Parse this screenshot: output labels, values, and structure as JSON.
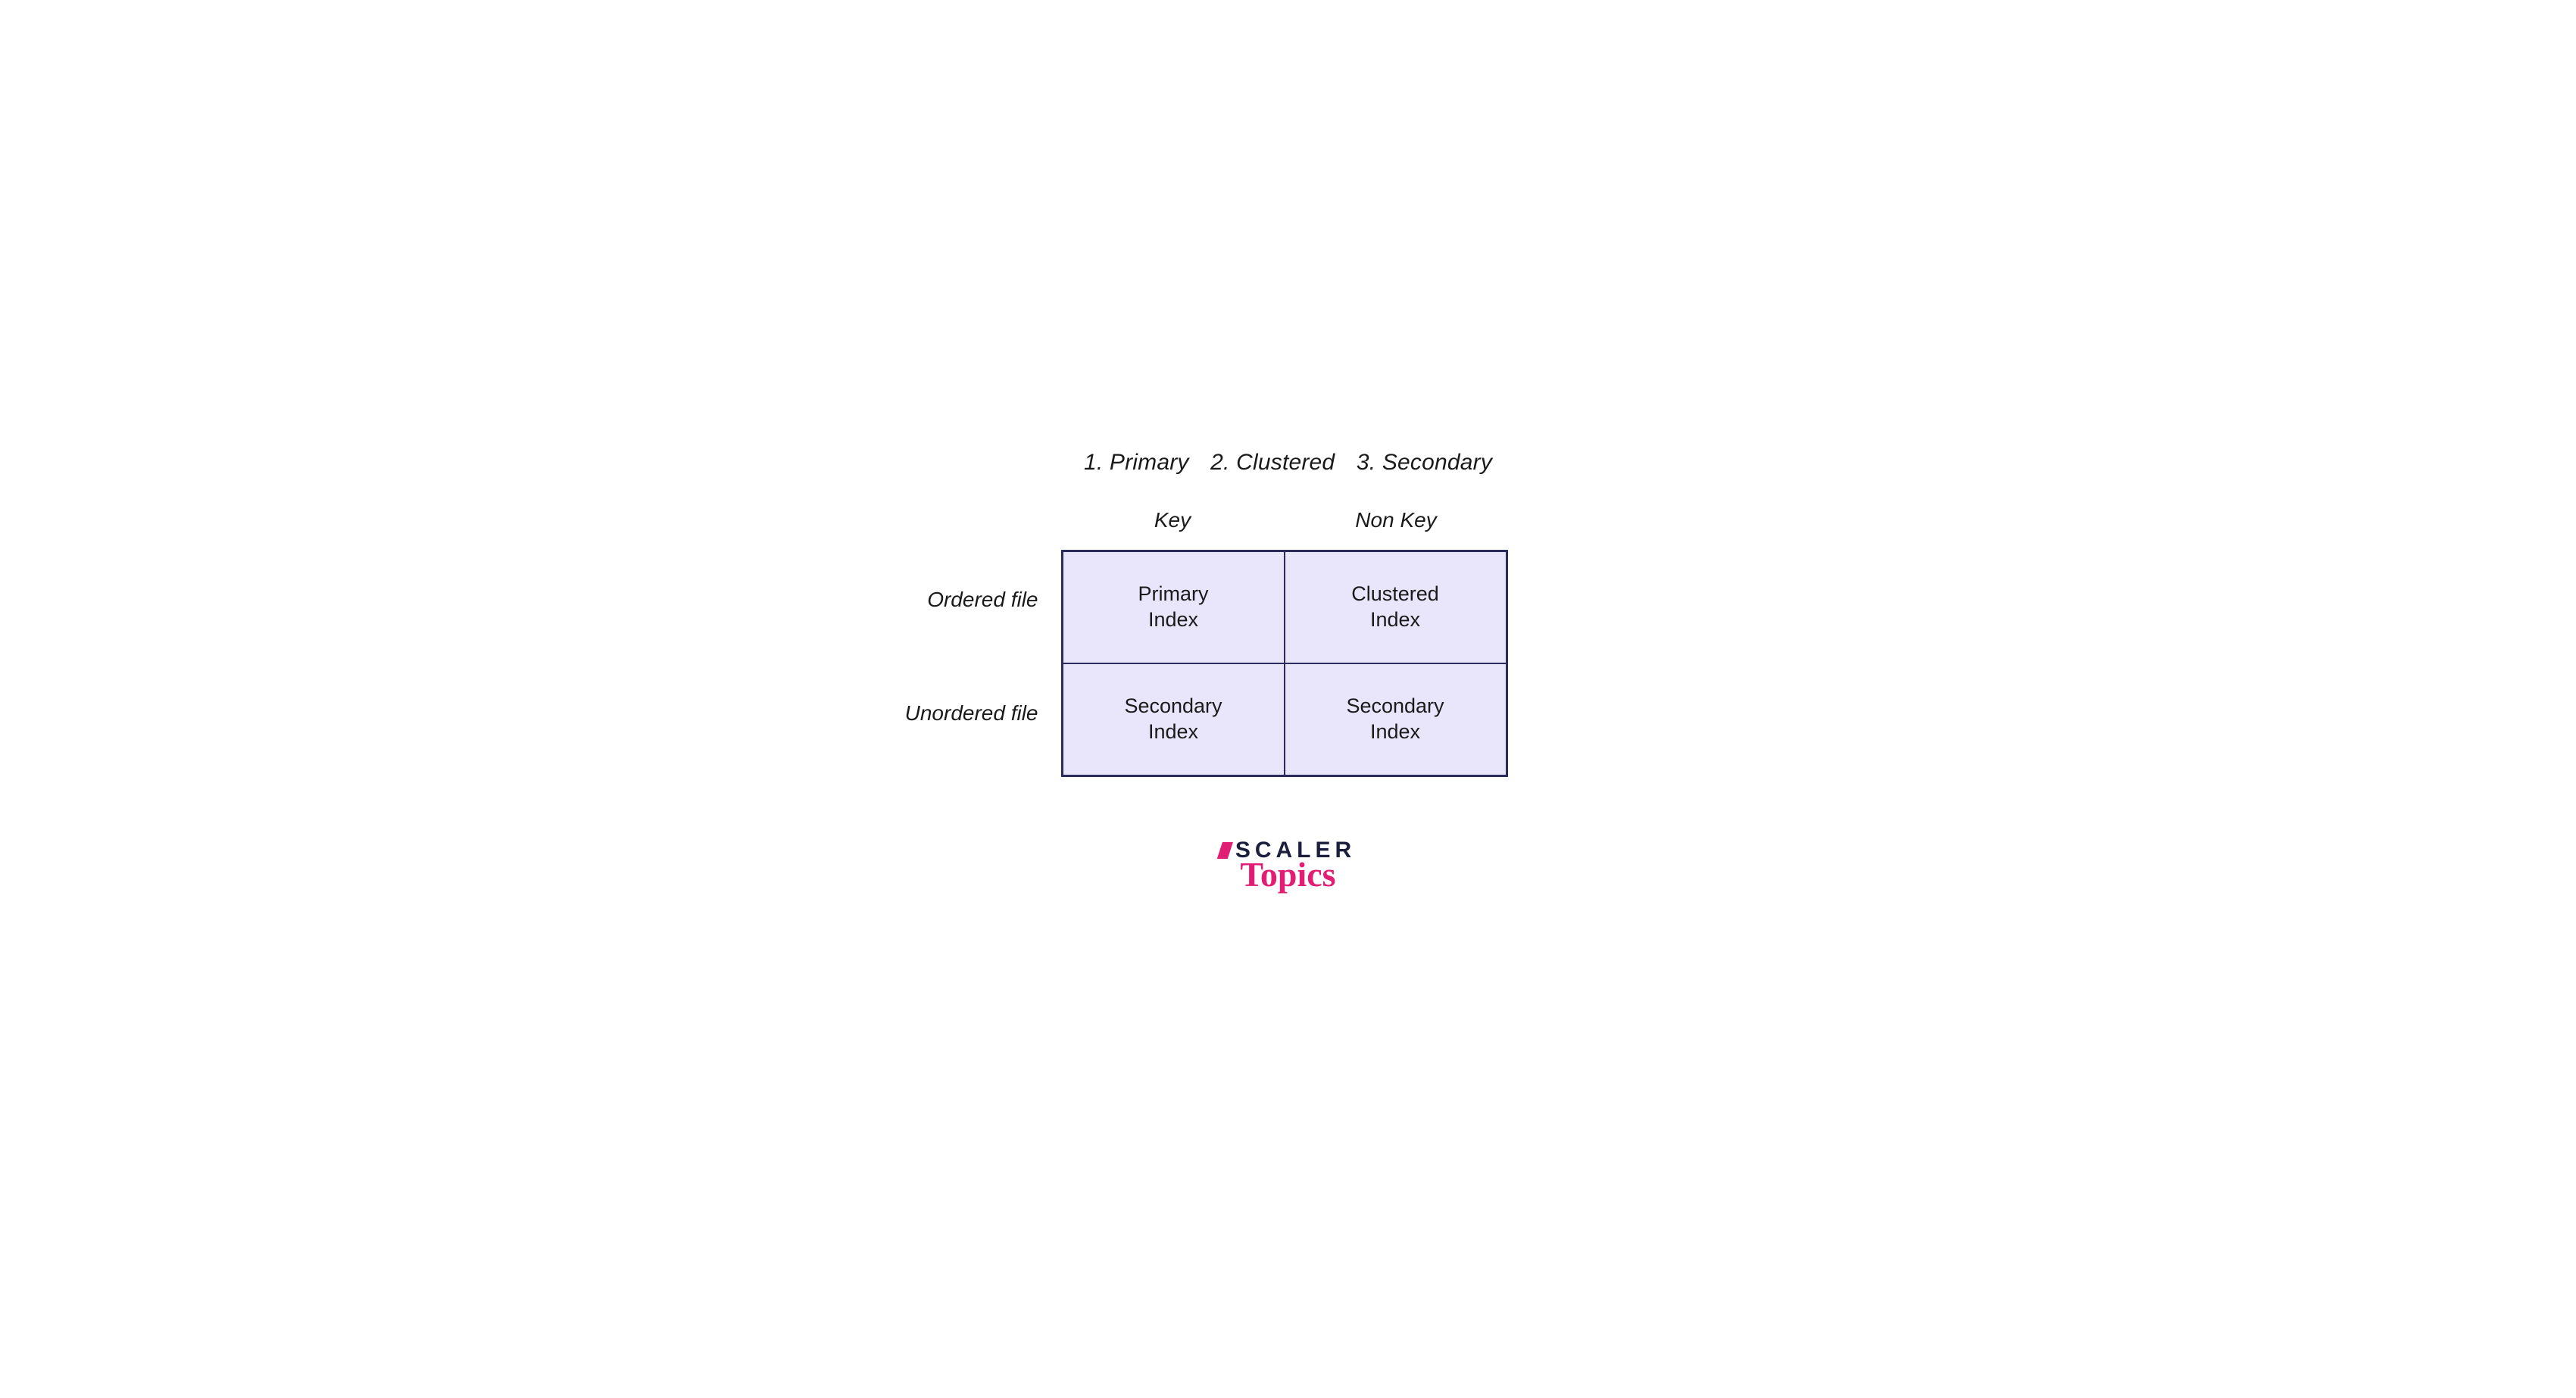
{
  "title": {
    "item1": "1. Primary",
    "item2": "2. Clustered",
    "item3": "3. Secondary"
  },
  "columns": {
    "key": "Key",
    "nonkey": "Non Key"
  },
  "rows": {
    "ordered": "Ordered file",
    "unordered": "Unordered file"
  },
  "cells": {
    "r1c1_l1": "Primary",
    "r1c1_l2": "Index",
    "r1c2_l1": "Clustered",
    "r1c2_l2": "Index",
    "r2c1_l1": "Secondary",
    "r2c1_l2": "Index",
    "r2c2_l1": "Secondary",
    "r2c2_l2": "Index"
  },
  "logo": {
    "scaler": "SCALER",
    "topics": "Topics"
  },
  "colors": {
    "cell_bg": "#e9e6fc",
    "cell_border": "#2b2b60",
    "logo_dark": "#1b1e3c",
    "logo_pink": "#e11d74"
  }
}
